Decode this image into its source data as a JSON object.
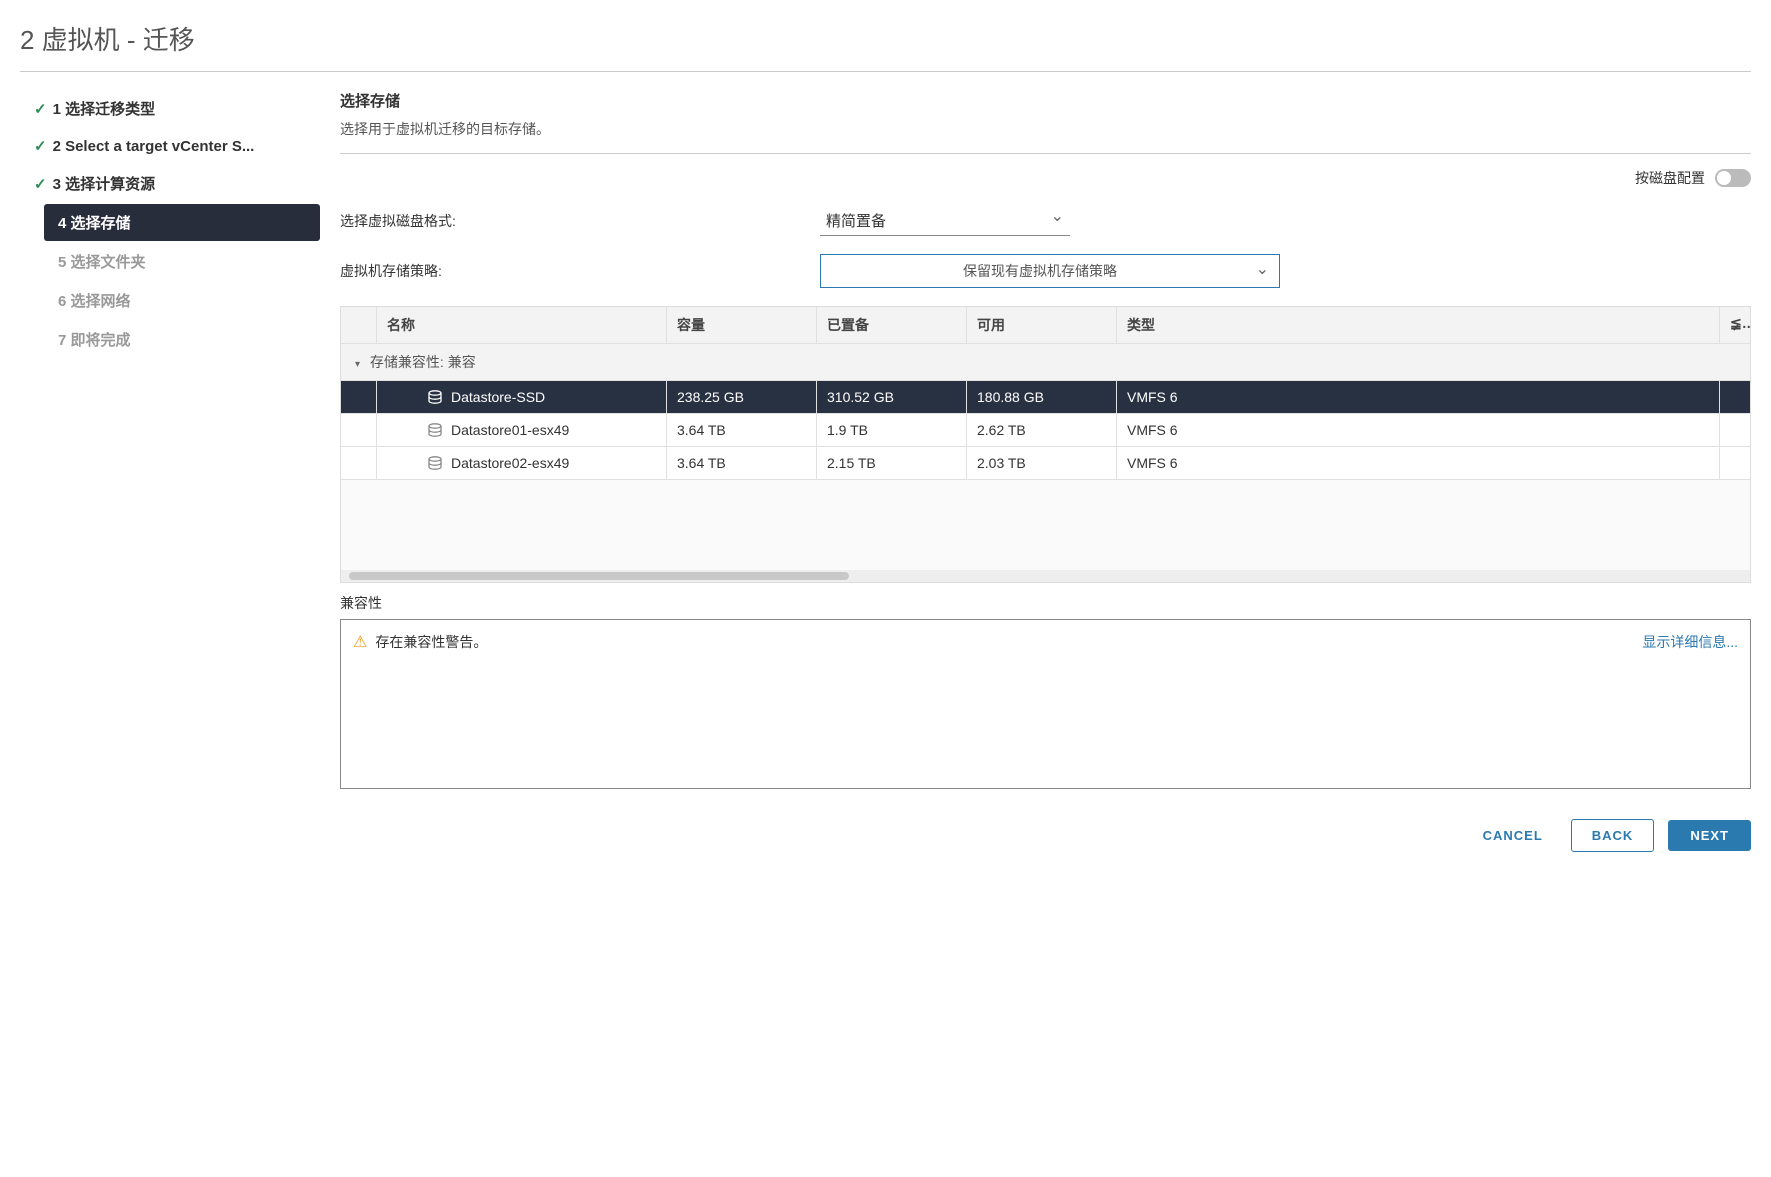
{
  "title": "2 虚拟机 - 迁移",
  "steps": [
    {
      "label": "1 选择迁移类型",
      "state": "done"
    },
    {
      "label": "2 Select a target vCenter S...",
      "state": "done"
    },
    {
      "label": "3 选择计算资源",
      "state": "done"
    },
    {
      "label": "4 选择存储",
      "state": "active"
    },
    {
      "label": "5 选择文件夹",
      "state": "pending"
    },
    {
      "label": "6 选择网络",
      "state": "pending"
    },
    {
      "label": "7 即将完成",
      "state": "pending"
    }
  ],
  "section": {
    "title": "选择存储",
    "desc": "选择用于虚拟机迁移的目标存储。"
  },
  "toggle_label": "按磁盘配置",
  "disk_format": {
    "label": "选择虚拟磁盘格式:",
    "value": "精简置备"
  },
  "storage_policy": {
    "label": "虚拟机存储策略:",
    "value": "保留现有虚拟机存储策略"
  },
  "grid": {
    "headers": {
      "name": "名称",
      "capacity": "容量",
      "provisioned": "已置备",
      "free": "可用",
      "type": "类型",
      "extra": "≨"
    },
    "group_label": "存储兼容性: 兼容",
    "rows": [
      {
        "name": "Datastore-SSD",
        "capacity": "238.25 GB",
        "provisioned": "310.52 GB",
        "free": "180.88 GB",
        "type": "VMFS 6",
        "selected": true
      },
      {
        "name": "Datastore01-esx49",
        "capacity": "3.64 TB",
        "provisioned": "1.9 TB",
        "free": "2.62 TB",
        "type": "VMFS 6",
        "selected": false
      },
      {
        "name": "Datastore02-esx49",
        "capacity": "3.64 TB",
        "provisioned": "2.15 TB",
        "free": "2.03 TB",
        "type": "VMFS 6",
        "selected": false
      }
    ]
  },
  "compat": {
    "label": "兼容性",
    "message": "存在兼容性警告。",
    "details_link": "显示详细信息..."
  },
  "footer": {
    "cancel": "CANCEL",
    "back": "BACK",
    "next": "NEXT"
  }
}
